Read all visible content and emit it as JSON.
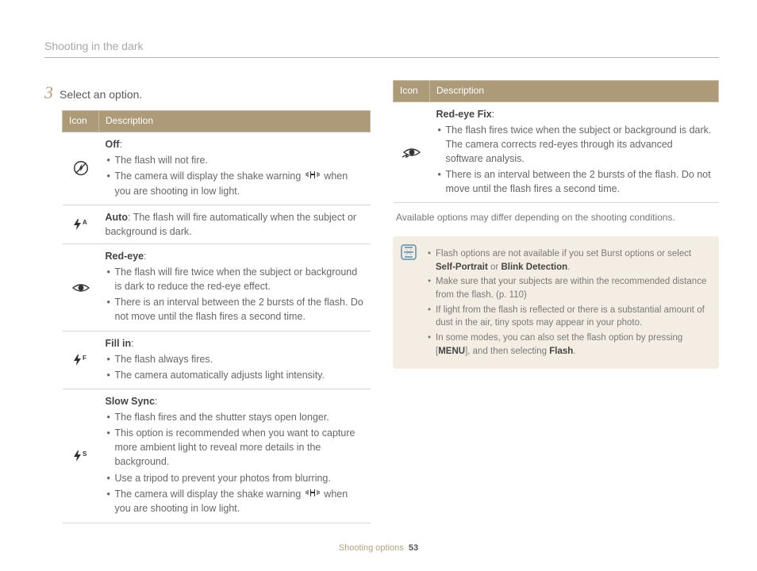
{
  "header": {
    "title": "Shooting in the dark"
  },
  "step": {
    "number": "3",
    "text": "Select an option."
  },
  "tableHeaders": {
    "icon": "Icon",
    "description": "Description"
  },
  "leftRows": {
    "off": {
      "title": "Off",
      "b1": "The flash will not fire.",
      "b2a": "The camera will display the shake warning ",
      "b2b": " when you are shooting in low light."
    },
    "auto": {
      "title": "Auto",
      "text": ": The flash will fire automatically when the subject or background is dark."
    },
    "redeye": {
      "title": "Red-eye",
      "b1": "The flash will fire twice when the subject or background is dark to reduce the red-eye effect.",
      "b2": "There is an interval between the 2 bursts of the flash. Do not move until the flash fires a second time."
    },
    "fillin": {
      "title": "Fill in",
      "b1": "The flash always fires.",
      "b2": "The camera automatically adjusts light intensity."
    },
    "slow": {
      "title": "Slow Sync",
      "b1": "The flash fires and the shutter stays open longer.",
      "b2": "This option is recommended when you want to capture more ambient light to reveal more details in the background.",
      "b3": "Use a tripod to prevent your photos from blurring.",
      "b4a": "The camera will display the shake warning ",
      "b4b": " when you are shooting in low light."
    }
  },
  "rightRows": {
    "redeyefix": {
      "title": "Red-eye Fix",
      "b1": "The flash fires twice when the subject or background is dark. The camera corrects red-eyes through its advanced software analysis.",
      "b2": "There is an interval between the 2 bursts of the flash. Do not move until the flash fires a second time."
    }
  },
  "availableNote": "Available options may differ depending on the shooting conditions.",
  "noteBox": {
    "n1a": "Flash options are not available if you set Burst options or select ",
    "n1b": "Self-Portrait",
    "n1c": " or ",
    "n1d": "Blink Detection",
    "n1e": ".",
    "n2": "Make sure that your subjects are within the recommended distance from the flash. (p. 110)",
    "n3": "If light from the flash is reflected or there is a substantial amount of dust in the air, tiny spots may appear in your photo.",
    "n4a": "In some modes, you can also set the flash option by pressing [",
    "n4menu": "MENU",
    "n4b": "], and then selecting ",
    "n4c": "Flash",
    "n4d": "."
  },
  "footer": {
    "section": "Shooting options",
    "page": "53"
  }
}
